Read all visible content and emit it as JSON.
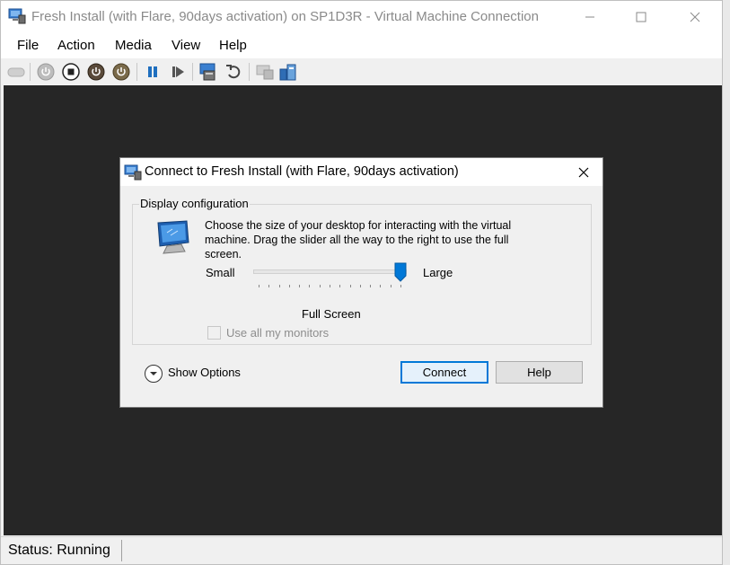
{
  "window": {
    "title": "Fresh Install (with Flare, 90days activation) on SP1D3R - Virtual Machine Connection"
  },
  "menu": {
    "items": [
      {
        "label": "File"
      },
      {
        "label": "Action"
      },
      {
        "label": "Media"
      },
      {
        "label": "View"
      },
      {
        "label": "Help"
      }
    ]
  },
  "toolbar": {
    "buttons": [
      {
        "icon": "ctrl-alt-del-icon",
        "enabled": false
      },
      {
        "icon": "start-icon",
        "enabled": false
      },
      {
        "icon": "turn-off-icon"
      },
      {
        "icon": "shut-down-icon"
      },
      {
        "icon": "save-icon"
      },
      {
        "icon": "pause-icon"
      },
      {
        "icon": "resume-icon"
      },
      {
        "icon": "checkpoint-icon"
      },
      {
        "icon": "revert-icon"
      },
      {
        "icon": "enhanced-session-icon",
        "enabled": false
      },
      {
        "icon": "share-icon"
      }
    ]
  },
  "status": {
    "text": "Status: Running"
  },
  "dialog": {
    "title": "Connect to Fresh Install (with Flare, 90days activation)",
    "group_label": "Display configuration",
    "description": "Choose the size of your desktop for interacting with the virtual machine. Drag the slider all the way to the right to use the full screen.",
    "slider": {
      "min_label": "Small",
      "max_label": "Large",
      "value_label": "Full Screen",
      "position_fraction": 1.0
    },
    "checkbox": {
      "label": "Use all my monitors",
      "checked": false,
      "enabled": false
    },
    "show_options_label": "Show Options",
    "connect_label": "Connect",
    "help_label": "Help"
  },
  "colors": {
    "accent": "#0078d7",
    "screen_bg": "#262626",
    "disabled_text": "#8d8d8d"
  }
}
